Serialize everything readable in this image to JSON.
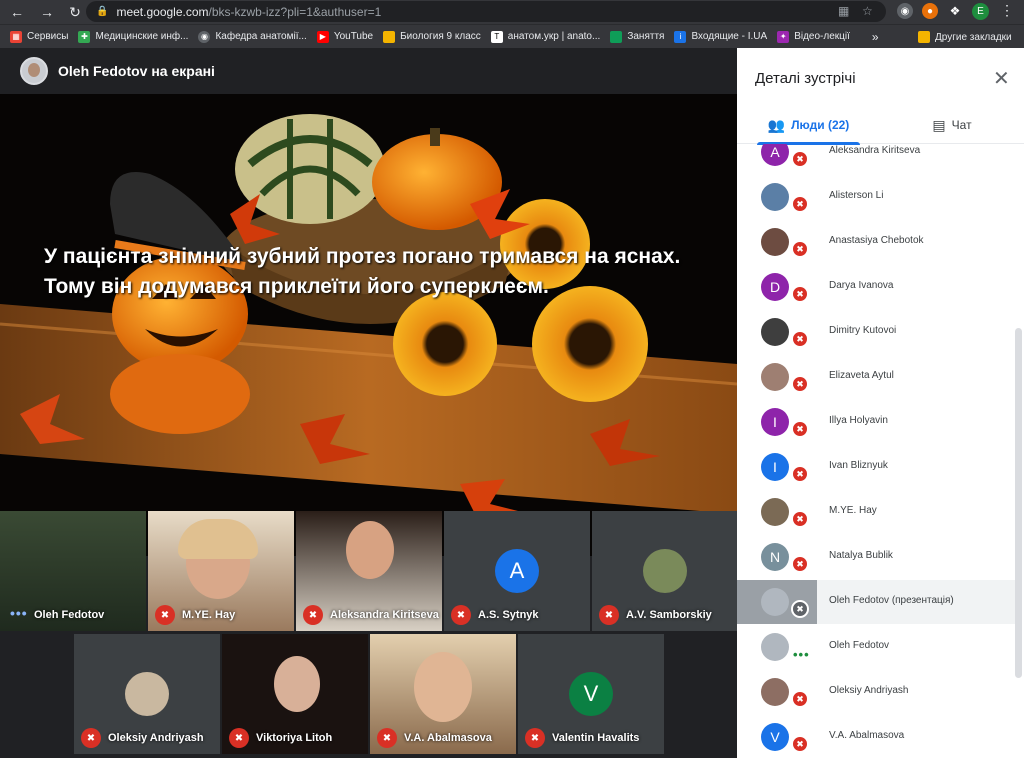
{
  "browser": {
    "url_host": "meet.google.com",
    "url_path": "/bks-kzwb-izz?pli=1&authuser=1",
    "profile_initial": "E"
  },
  "bookmarks": [
    {
      "label": "Сервисы",
      "icon": "apps-grid-icon",
      "color": "#ea4335"
    },
    {
      "label": "Медицинские инф...",
      "icon": "medical-icon",
      "color": "#34a853"
    },
    {
      "label": "Кафедра анатомії...",
      "icon": "globe-icon",
      "color": "#5f6368"
    },
    {
      "label": "YouTube",
      "icon": "youtube-icon",
      "color": "#ff0000"
    },
    {
      "label": "Биология 9 класс",
      "icon": "folder-icon",
      "color": "#f4b400"
    },
    {
      "label": "анатом.укр | anato...",
      "icon": "text-icon",
      "color": "#ffffff"
    },
    {
      "label": "Заняття",
      "icon": "classroom-icon",
      "color": "#0f9d58"
    },
    {
      "label": "Входящие - I.UA",
      "icon": "mail-icon",
      "color": "#1a73e8"
    },
    {
      "label": "Відео-лекції",
      "icon": "video-icon",
      "color": "#9c27b0"
    }
  ],
  "bookmarks_more": "»",
  "bookmarks_other": "Другие закладки",
  "presenter": {
    "label": "Oleh Fedotov на екрані"
  },
  "slide": {
    "text": "У пацієнта знімний зубний протез погано тримався на яснах. Тому він додумався приклеїти його суперклеєм."
  },
  "tiles_row1": [
    {
      "name": "Oleh Fedotov",
      "status": "speaking"
    },
    {
      "name": "M.YE. Hay",
      "status": "muted"
    },
    {
      "name": "Aleksandra Kiritseva",
      "status": "muted"
    },
    {
      "name": "A.S. Sytnyk",
      "status": "muted",
      "letter": "A",
      "color": "#1a73e8"
    },
    {
      "name": "A.V. Samborskiy",
      "status": "muted"
    }
  ],
  "tiles_row2": [
    {
      "name": "Oleksiy Andriyash",
      "status": "muted"
    },
    {
      "name": "Viktoriya Litoh",
      "status": "muted"
    },
    {
      "name": "V.A. Abalmasova",
      "status": "muted"
    },
    {
      "name": "Valentin Havalits",
      "status": "muted",
      "letter": "V",
      "color": "#0b8043"
    }
  ],
  "panel": {
    "title": "Деталі зустрічі",
    "tab_people": "Люди (22)",
    "tab_chat": "Чат"
  },
  "people": [
    {
      "name": "Aleksandra Kiritseva",
      "letter": "A",
      "color": "#8e24aa",
      "mic": "muted"
    },
    {
      "name": "Alisterson Li",
      "letter": "",
      "color": "#5b7fa6",
      "mic": "muted"
    },
    {
      "name": "Anastasiya Chebotok",
      "letter": "",
      "color": "#6d4c41",
      "mic": "muted"
    },
    {
      "name": "Darya Ivanova",
      "letter": "D",
      "color": "#8e24aa",
      "mic": "muted"
    },
    {
      "name": "Dimitry Kutovoi",
      "letter": "",
      "color": "#3e3e3e",
      "mic": "muted"
    },
    {
      "name": "Elizaveta Aytul",
      "letter": "",
      "color": "#9e7f72",
      "mic": "muted"
    },
    {
      "name": "Illya Holyavin",
      "letter": "I",
      "color": "#8e24aa",
      "mic": "muted"
    },
    {
      "name": "Ivan Bliznyuk",
      "letter": "I",
      "color": "#1a73e8",
      "mic": "muted"
    },
    {
      "name": "M.YE. Hay",
      "letter": "",
      "color": "#7b6a55",
      "mic": "muted"
    },
    {
      "name": "Natalya Bublik",
      "letter": "N",
      "color": "#78909c",
      "mic": "muted"
    },
    {
      "name": "Oleh Fedotov (презентація)",
      "letter": "",
      "color": "#9aa0a6",
      "mic": "presenting"
    },
    {
      "name": "Oleh Fedotov",
      "letter": "",
      "color": "#b0b7bf",
      "mic": "speaking"
    },
    {
      "name": "Oleksiy Andriyash",
      "letter": "",
      "color": "#8d6e63",
      "mic": "muted"
    },
    {
      "name": "V.A. Abalmasova",
      "letter": "V",
      "color": "#1a73e8",
      "mic": "muted"
    }
  ]
}
